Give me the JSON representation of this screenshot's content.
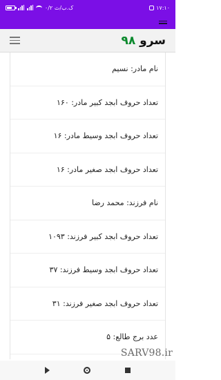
{
  "status_bar": {
    "time": "۱۷:۱۰",
    "speed": "۰/۲ ک.ب/ث",
    "battery_label": ""
  },
  "header": {
    "logo_number": "۹۸",
    "logo_word": "سرو"
  },
  "rows": [
    "نام مادر: نسیم",
    "تعداد حروف ابجد کبیر مادر: ۱۶۰",
    "تعداد حروف ابجد وسیط مادر: ۱۶",
    "تعداد حروف ابجد صغیر مادر: ۱۶",
    "نام فرزند: محمد رضا",
    "تعداد حروف ابجد کبیر فرزند: ۱۰۹۳",
    "تعداد حروف ابجد وسیط فرزند: ۳۷",
    "تعداد حروف ابجد صغیر فرزند: ۳۱",
    "عدد برج طالع: ۵"
  ],
  "watermark": "SARV98.ir",
  "colors": {
    "status_bar": "#7b0fe6",
    "logo_number": "#0c8a2e"
  }
}
